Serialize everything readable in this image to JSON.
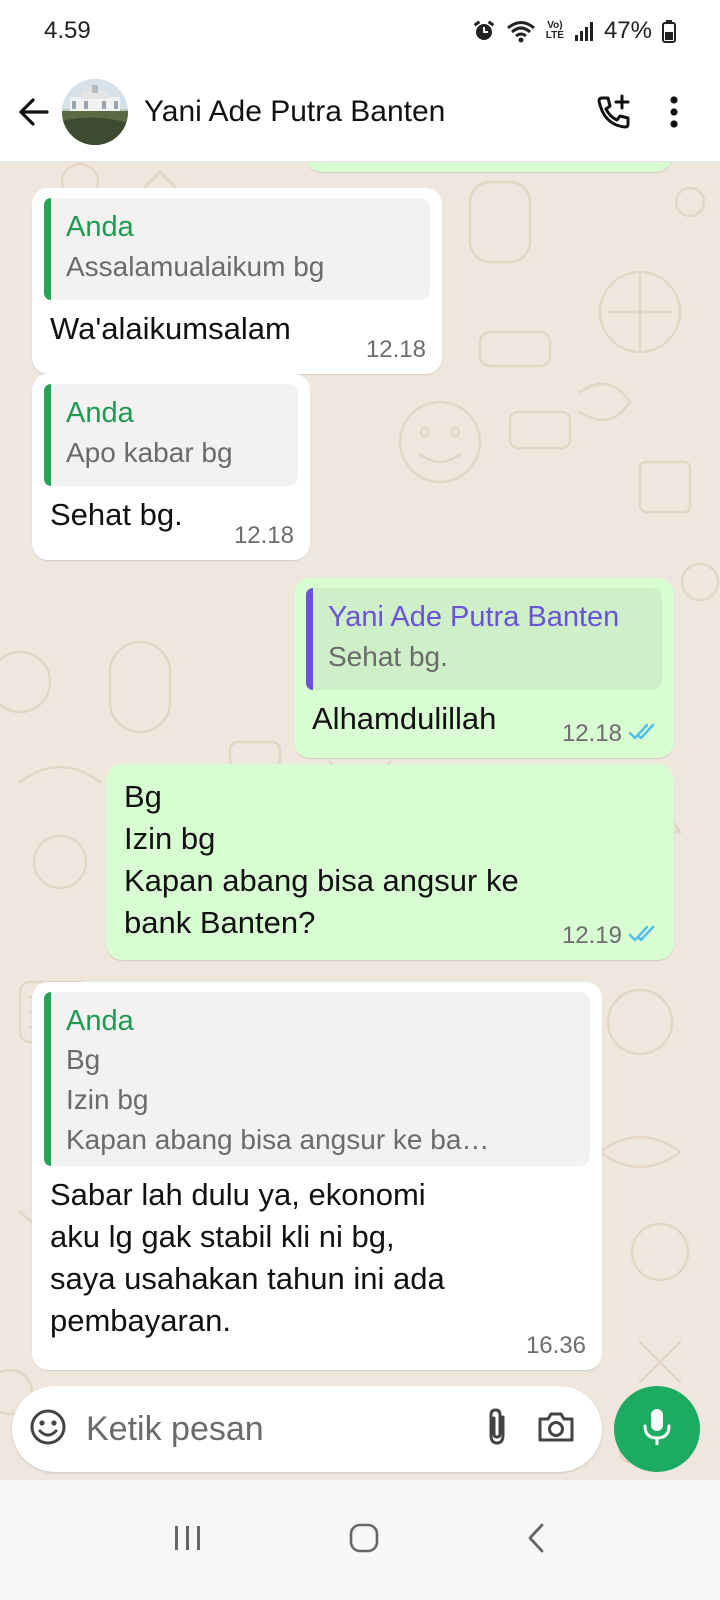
{
  "status_bar": {
    "time": "4.59",
    "battery": "47%",
    "network_label": "LTE"
  },
  "header": {
    "title": "Yani Ade Putra Banten",
    "icons": [
      "back-arrow-icon",
      "add-call-icon",
      "more-vert-icon"
    ]
  },
  "messages": [
    {
      "direction": "in",
      "quote_author": "Anda",
      "quote_text": "Assalamualaikum bg",
      "text": "Wa'alaikumsalam",
      "time": "12.18"
    },
    {
      "direction": "in",
      "quote_author": "Anda",
      "quote_text": "Apo kabar bg",
      "text": "Sehat bg.",
      "time": "12.18"
    },
    {
      "direction": "out",
      "quote_author": "Yani Ade Putra Banten",
      "quote_text": "Sehat bg.",
      "text": "Alhamdulillah",
      "time": "12.18",
      "read": true
    },
    {
      "direction": "out",
      "text": "Bg\nIzin bg\nKapan abang bisa angsur ke\nbank Banten?",
      "time": "12.19",
      "read": true
    },
    {
      "direction": "in",
      "quote_author": "Anda",
      "quote_text": "Bg\nIzin bg\nKapan abang bisa angsur ke ba…",
      "text": "Sabar lah dulu ya, ekonomi\naku lg gak stabil kli ni bg,\nsaya usahakan tahun ini ada\npembayaran.",
      "time": "16.36"
    }
  ],
  "input": {
    "placeholder": "Ketik pesan"
  },
  "colors": {
    "header_bg": "#ffffff",
    "chat_bg": "#efe7de",
    "incoming_bubble": "#ffffff",
    "outgoing_bubble": "#d9fdd3",
    "quote_green": "#1f9a52",
    "quote_purple": "#6a53d8",
    "read_ticks": "#53bdeb",
    "mic_button": "#1daa61"
  }
}
